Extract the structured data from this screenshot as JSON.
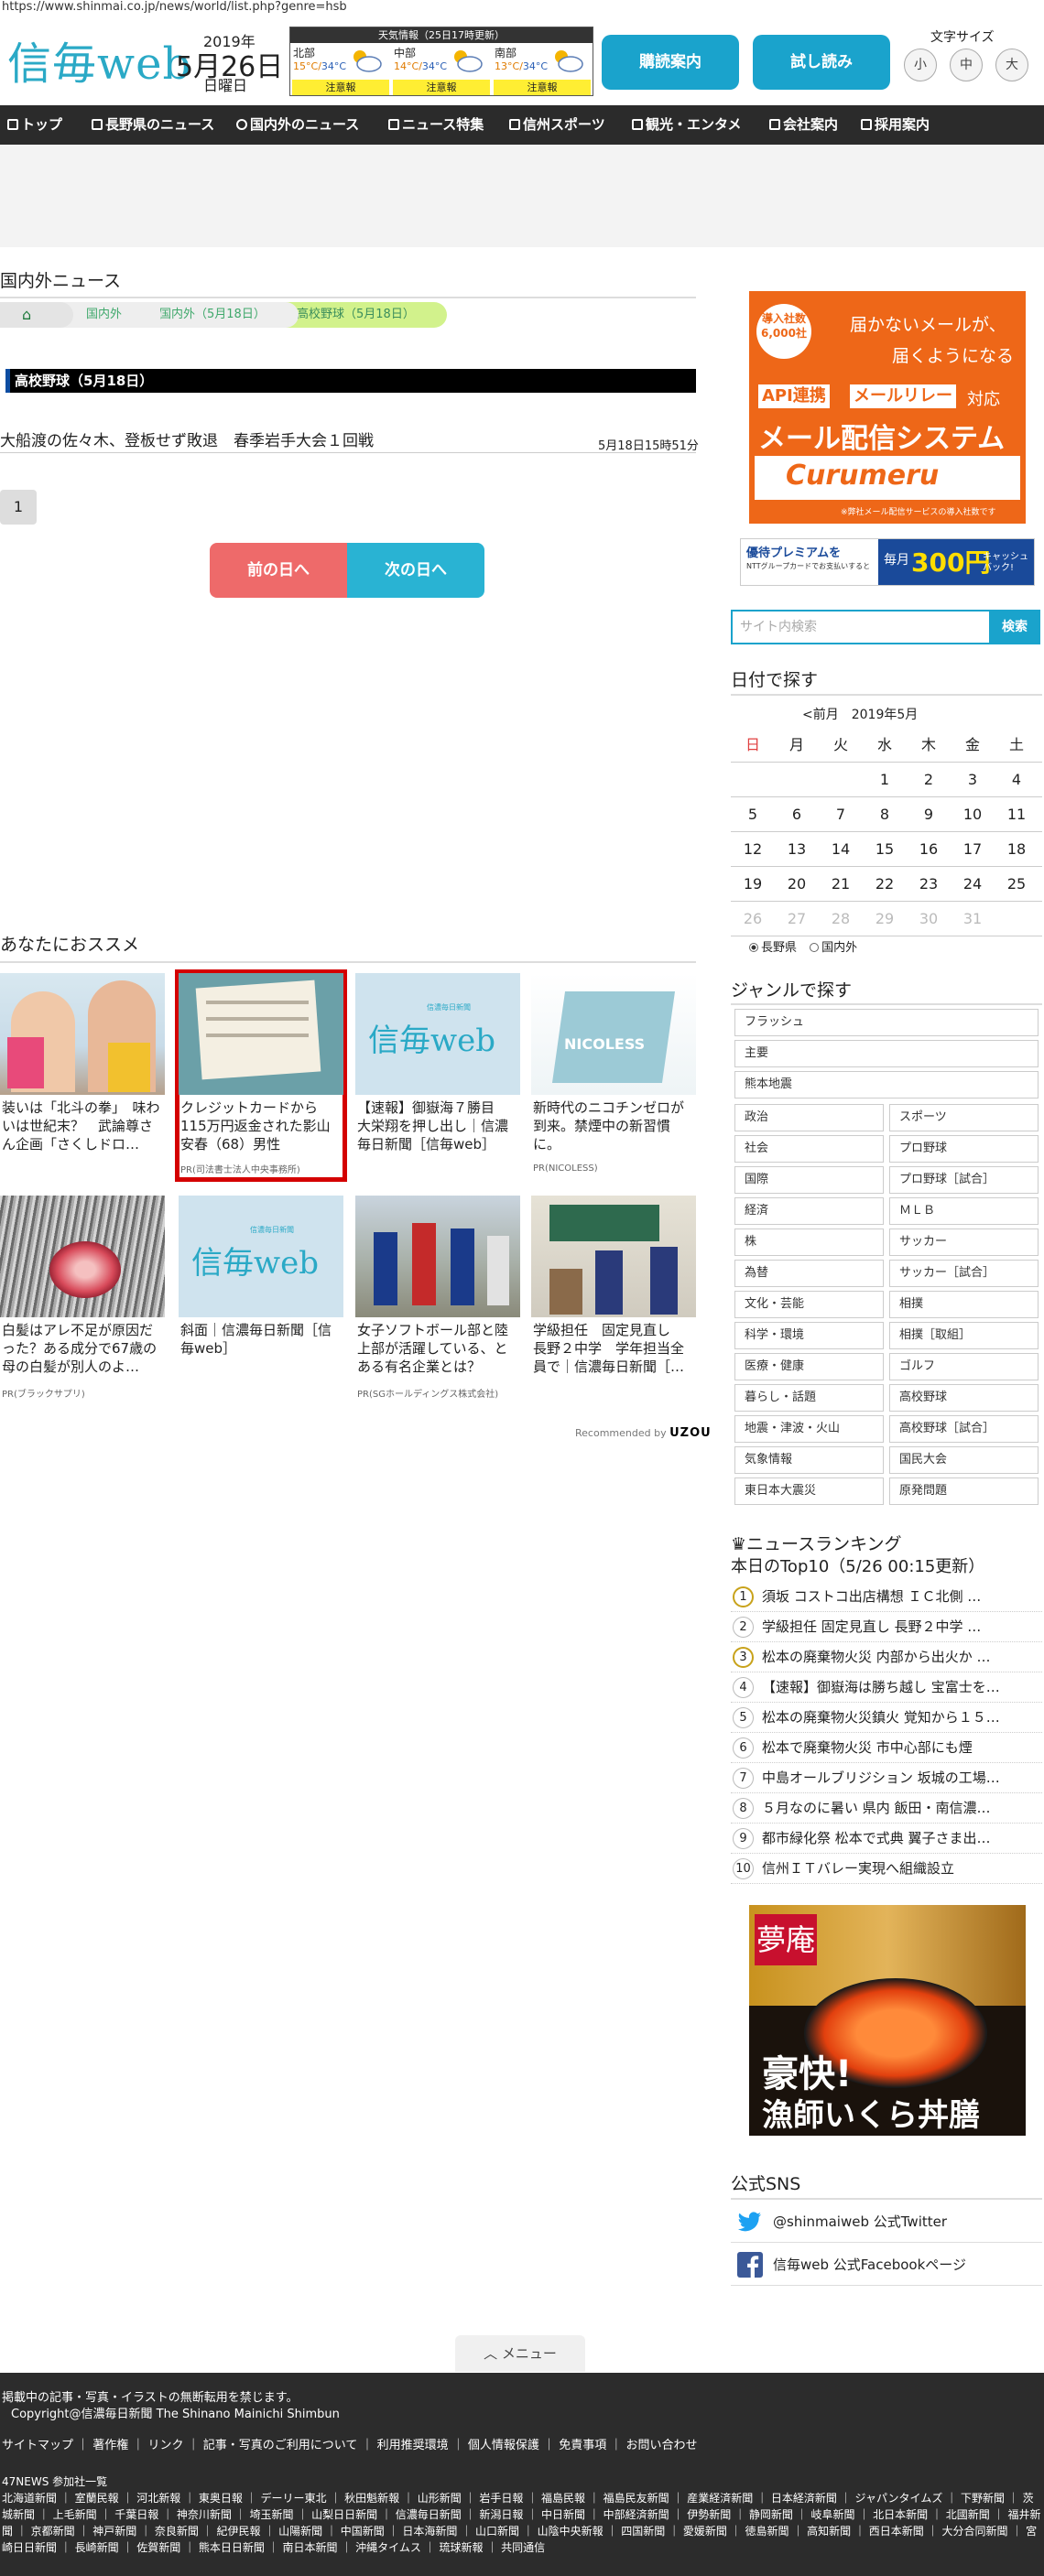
{
  "browser": {
    "url": "https://www.shinmai.co.jp/news/world/list.php?genre=hsb"
  },
  "header": {
    "logo_text": "信毎web",
    "date": {
      "year": "2019年",
      "month_day": "5月26日",
      "weekday": "日曜日"
    },
    "weather": {
      "title": "天気情報（25日17時更新）",
      "regions": [
        {
          "name": "北部",
          "temp_high": "15°C",
          "temp_low": "34°C",
          "alert": "注意報"
        },
        {
          "name": "中部",
          "temp_high": "14°C",
          "temp_low": "34°C",
          "alert": "注意報"
        },
        {
          "name": "南部",
          "temp_high": "13°C",
          "temp_low": "34°C",
          "alert": "注意報"
        }
      ]
    },
    "buttons": {
      "subscribe": "購読案内",
      "trial": "試し読み"
    },
    "font_size": {
      "label": "文字サイズ",
      "small": "小",
      "medium": "中",
      "large": "大"
    }
  },
  "nav": [
    {
      "label": "トップ"
    },
    {
      "label": "長野県のニュース"
    },
    {
      "label": "国内外のニュース"
    },
    {
      "label": "ニュース特集"
    },
    {
      "label": "信州スポーツ"
    },
    {
      "label": "観光・エンタメ"
    },
    {
      "label": "会社案内"
    },
    {
      "label": "採用案内"
    }
  ],
  "main": {
    "section_title": "国内外ニュース",
    "breadcrumbs": [
      "国内外",
      "国内外（5月18日）",
      "高校野球（5月18日）"
    ],
    "category_title": "高校野球（5月18日）",
    "article": {
      "title": "大船渡の佐々木、登板せず敗退　春季岩手大会１回戦",
      "time": "5月18日15時51分"
    },
    "pager": "1",
    "prev_day": "前の日へ",
    "next_day": "次の日へ",
    "recommend_title": "あなたにおススメ",
    "cards": [
      {
        "text": "装いは「北斗の拳」　味わいは世紀末？　武論尊さん企画「さくしドロ…",
        "pr": ""
      },
      {
        "text": "クレジットカードから115万円返金された影山安春（68）男性",
        "pr": "PR(司法書士法人中央事務所)"
      },
      {
        "text": "【速報】御嶽海７勝目　大栄翔を押し出し｜信濃毎日新聞［信毎web］",
        "pr": ""
      },
      {
        "text": "新時代のニコチンゼロが到来。禁煙中の新習慣に。",
        "pr": "PR(NICOLESS)"
      },
      {
        "text": "白髪はアレ不足が原因だった？ある成分で67歳の母の白髪が別人のよ…",
        "pr": "PR(ブラックサプリ)"
      },
      {
        "text": "斜面｜信濃毎日新聞［信毎web］",
        "pr": ""
      },
      {
        "text": "女子ソフトボール部と陸上部が活躍している、とある有名企業とは？",
        "pr": "PR(SGホールディングス株式会社)"
      },
      {
        "text": "学級担任　固定見直し　長野２中学　学年担当全員で｜信濃毎日新聞［…",
        "pr": ""
      }
    ],
    "card_image_labels": {
      "web_logo": "信毎web",
      "web_sub": "信濃毎日新聞",
      "nicoless": "NICOLESS"
    },
    "recommended_by": "Recommended by",
    "recommended_brand": "UZOU"
  },
  "sidebar": {
    "ad1": {
      "badge": "導入社数6,000社",
      "line1": "届かないメールが、",
      "line2": "届くようになる",
      "tag1": "API連携",
      "tag2": "メールリレー",
      "tag3": "対応",
      "headline": "メール配信システム",
      "brand": "Curumeru",
      "note": "※弊社メール配信サービスの導入社数です"
    },
    "ad2": {
      "left": "優待プレミアムを",
      "sub": "NTTグループカードでお支払いすると",
      "mid": "毎月",
      "amount": "300円",
      "right": "キャッシュバック!"
    },
    "search": {
      "placeholder": "サイト内検索",
      "button": "検索"
    },
    "date_title": "日付で探す",
    "calendar": {
      "prev": "<前月",
      "month_label": "2019年5月",
      "weekdays": [
        "日",
        "月",
        "火",
        "水",
        "木",
        "金",
        "土"
      ],
      "weeks": [
        [
          "",
          "",
          "",
          "1",
          "2",
          "3",
          "4"
        ],
        [
          "5",
          "6",
          "7",
          "8",
          "9",
          "10",
          "11"
        ],
        [
          "12",
          "13",
          "14",
          "15",
          "16",
          "17",
          "18"
        ],
        [
          "19",
          "20",
          "21",
          "22",
          "23",
          "24",
          "25"
        ],
        [
          "26",
          "27",
          "28",
          "29",
          "30",
          "31",
          ""
        ]
      ],
      "radio_nagano": "長野県",
      "radio_world": "国内外"
    },
    "genre_title": "ジャンルで探す",
    "genres_full": [
      "フラッシュ",
      "主要",
      "熊本地震"
    ],
    "genres_pairs": [
      [
        "政治",
        "スポーツ"
      ],
      [
        "社会",
        "プロ野球"
      ],
      [
        "国際",
        "プロ野球［試合］"
      ],
      [
        "経済",
        "ＭＬＢ"
      ],
      [
        "株",
        "サッカー"
      ],
      [
        "為替",
        "サッカー［試合］"
      ],
      [
        "文化・芸能",
        "相撲"
      ],
      [
        "科学・環境",
        "相撲［取組］"
      ],
      [
        "医療・健康",
        "ゴルフ"
      ],
      [
        "暮らし・話題",
        "高校野球"
      ],
      [
        "地震・津波・火山",
        "高校野球［試合］"
      ],
      [
        "気象情報",
        "国民大会"
      ],
      [
        "東日本大震災",
        "原発問題"
      ]
    ],
    "ranking": {
      "title": "ニュースランキング",
      "subtitle": "本日のTop10（5/26 00:15更新）",
      "items": [
        {
          "num": "1",
          "text": "須坂 コストコ出店構想 ＩＣ北側 …"
        },
        {
          "num": "2",
          "text": "学級担任 固定見直し 長野２中学 …"
        },
        {
          "num": "3",
          "text": "松本の廃棄物火災 内部から出火か …"
        },
        {
          "num": "4",
          "text": "【速報】御嶽海は勝ち越し 宝富士を…"
        },
        {
          "num": "5",
          "text": "松本の廃棄物火災鎮火 覚知から１５…"
        },
        {
          "num": "6",
          "text": "松本で廃棄物火災 市中心部にも煙"
        },
        {
          "num": "7",
          "text": "中島オールブリジション 坂城の工場…"
        },
        {
          "num": "8",
          "text": "５月なのに暑い 県内 飯田・南信濃…"
        },
        {
          "num": "9",
          "text": "都市緑化祭 松本で式典 翼子さま出…"
        },
        {
          "num": "10",
          "text": "信州ＩＴバレー実現へ組織設立"
        }
      ]
    },
    "ad3": {
      "brand": "夢庵",
      "line1": "豪快!",
      "line2": "漁師いくら丼膳"
    },
    "sns": {
      "title": "公式SNS",
      "twitter": "@shinmaiweb 公式Twitter",
      "facebook": "信毎web 公式Facebookページ"
    }
  },
  "footer": {
    "menu_tab": "メニュー",
    "notice": "掲載中の記事・写真・イラストの無断転用を禁じます。",
    "copyright": "Copyright@信濃毎日新聞 The Shinano Mainichi Shimbun",
    "links": "サイトマップ ｜ 著作権 ｜ リンク ｜ 記事・写真のご利用について ｜ 利用推奨環境 ｜ 個人情報保護 ｜ 免責事項 ｜ お問い合わせ",
    "partners_title": "47NEWS 参加社一覧",
    "partners": "北海道新聞 ｜ 室蘭民報 ｜ 河北新報 ｜ 東奥日報 ｜ デーリー東北 ｜ 秋田魁新報 ｜ 山形新聞 ｜ 岩手日報 ｜ 福島民報 ｜ 福島民友新聞 ｜ 産業経済新聞 ｜ 日本経済新聞 ｜ ジャパンタイムズ ｜ 下野新聞 ｜ 茨城新聞 ｜ 上毛新聞 ｜ 千葉日報 ｜ 神奈川新聞 ｜ 埼玉新聞 ｜ 山梨日日新聞 ｜ 信濃毎日新聞 ｜ 新潟日報 ｜ 中日新聞 ｜ 中部経済新聞 ｜ 伊勢新聞 ｜ 静岡新聞 ｜ 岐阜新聞 ｜ 北日本新聞 ｜ 北國新聞 ｜ 福井新聞 ｜ 京都新聞 ｜ 神戸新聞 ｜ 奈良新聞 ｜ 紀伊民報 ｜ 山陽新聞 ｜ 中国新聞 ｜ 日本海新聞 ｜ 山口新聞 ｜ 山陰中央新報 ｜ 四国新聞 ｜ 愛媛新聞 ｜ 徳島新聞 ｜ 高知新聞 ｜ 西日本新聞 ｜ 大分合同新聞 ｜ 宮崎日日新聞 ｜ 長崎新聞 ｜ 佐賀新聞 ｜ 熊本日日新聞 ｜ 南日本新聞 ｜ 沖縄タイムス ｜ 琉球新報 ｜ 共同通信"
  }
}
